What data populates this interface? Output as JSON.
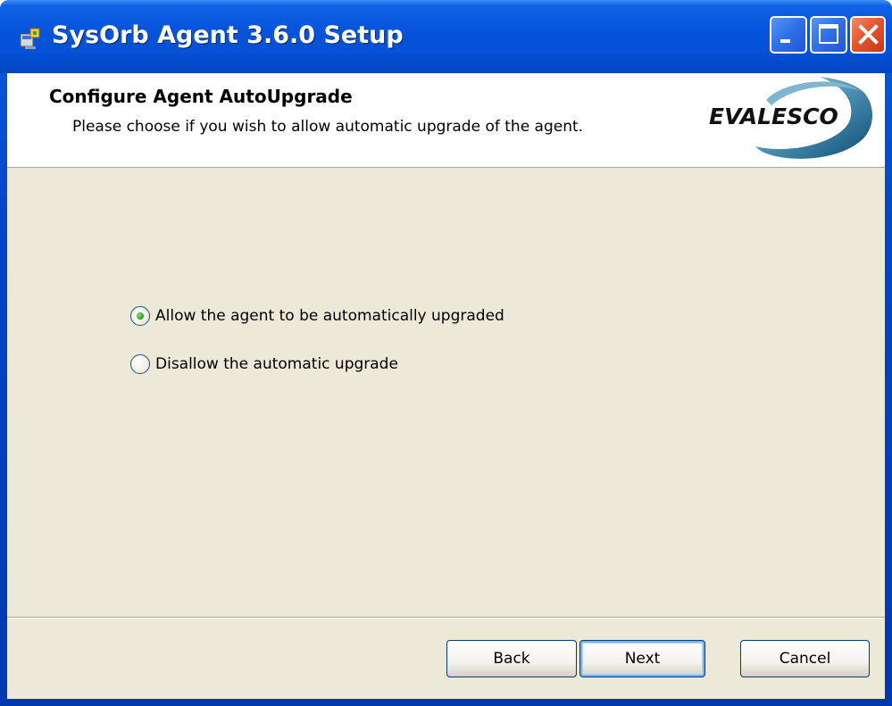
{
  "window": {
    "title": "SysOrb Agent 3.6.0 Setup",
    "title_icon": "installer-icon",
    "controls": [
      "minimize-icon",
      "maximize-icon",
      "close-icon"
    ]
  },
  "header": {
    "title": "Configure Agent AutoUpgrade",
    "description": "Please choose if you wish to allow automatic upgrade of the agent.",
    "logo_text": "EVALESCO"
  },
  "options": [
    {
      "label": "Allow the agent to be automatically upgraded",
      "selected": true
    },
    {
      "label": "Disallow the automatic upgrade",
      "selected": false
    }
  ],
  "buttons": {
    "back": "Back",
    "next": "Next",
    "cancel": "Cancel"
  },
  "colors": {
    "titlebar": "#0654dc",
    "client_bg": "#ece9d8",
    "radio_selected": "#21a121",
    "close_button": "#e5562f"
  }
}
